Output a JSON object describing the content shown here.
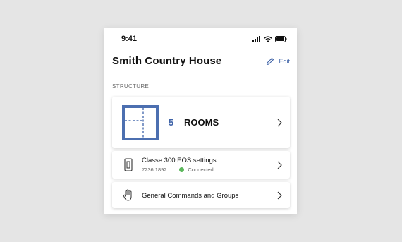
{
  "status_bar": {
    "time": "9:41",
    "icons": [
      "signal-icon",
      "wifi-icon",
      "battery-icon"
    ]
  },
  "header": {
    "title": "Smith Country House",
    "edit_label": "Edit"
  },
  "section_label": "STRUCTURE",
  "rooms_card": {
    "count": "5",
    "label": "ROOMS"
  },
  "eos_card": {
    "title": "Classe 300 EOS settings",
    "id": "7236 1892",
    "separator": "|",
    "status": "Connected"
  },
  "general_card": {
    "title": "General Commands and Groups"
  },
  "colors": {
    "accent": "#3f63a8",
    "status_connected": "#5cb85c",
    "background": "#e5e5e5"
  }
}
